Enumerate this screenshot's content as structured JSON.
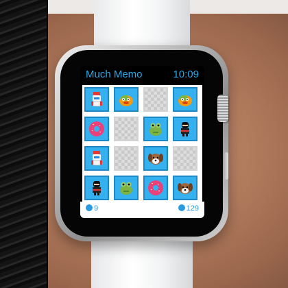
{
  "app": {
    "title": "Much Memo",
    "time": "10:09"
  },
  "board": {
    "cols": 4,
    "cards": [
      {
        "state": "face",
        "character": "robot-knight"
      },
      {
        "state": "face",
        "character": "orange-duck"
      },
      {
        "state": "back",
        "character": ""
      },
      {
        "state": "face",
        "character": "orange-duck"
      },
      {
        "state": "face",
        "character": "pink-donut"
      },
      {
        "state": "back",
        "character": ""
      },
      {
        "state": "face",
        "character": "green-frog"
      },
      {
        "state": "face",
        "character": "black-ninja"
      },
      {
        "state": "face",
        "character": "robot-knight"
      },
      {
        "state": "back",
        "character": ""
      },
      {
        "state": "face",
        "character": "brown-puppy"
      },
      {
        "state": "back",
        "character": ""
      },
      {
        "state": "face",
        "character": "black-ninja"
      },
      {
        "state": "face",
        "character": "green-frog"
      },
      {
        "state": "face",
        "character": "pink-donut"
      },
      {
        "state": "face",
        "character": "brown-puppy"
      }
    ]
  },
  "footer": {
    "moves": "9",
    "score": "129",
    "moves_icon": "person-icon",
    "score_icon": "bird-icon"
  },
  "colors": {
    "accent": "#27a9ea",
    "card_face": "#34b1ee",
    "card_back": "#d0d0d0"
  }
}
